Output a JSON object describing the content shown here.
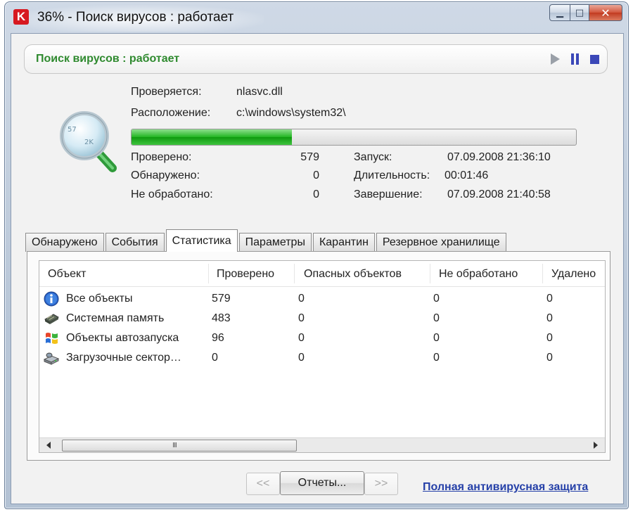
{
  "window": {
    "title": "36% - Поиск вирусов : работает",
    "app_icon_letter": "K",
    "controls": {
      "minimize": "▁",
      "maximize": "□",
      "close": "✕"
    }
  },
  "status": {
    "text": "Поиск вирусов : работает",
    "controls": [
      "play-icon",
      "pause-icon",
      "stop-icon"
    ]
  },
  "scan": {
    "checking_label": "Проверяется:",
    "checking_value": "nlasvc.dll",
    "location_label": "Расположение:",
    "location_value": "c:\\windows\\system32\\",
    "progress_percent": 36
  },
  "stats": {
    "checked_label": "Проверено:",
    "checked_value": "579",
    "detected_label": "Обнаружено:",
    "detected_value": "0",
    "unprocessed_label": "Не обработано:",
    "unprocessed_value": "0",
    "start_label": "Запуск:",
    "start_value": "07.09.2008 21:36:10",
    "duration_label": "Длительность:",
    "duration_value": "00:01:46",
    "end_label": "Завершение:",
    "end_value": "07.09.2008 21:40:58"
  },
  "tabs": [
    {
      "label": "Обнаружено"
    },
    {
      "label": "События"
    },
    {
      "label": "Статистика",
      "active": true
    },
    {
      "label": "Параметры"
    },
    {
      "label": "Карантин"
    },
    {
      "label": "Резервное хранилище"
    }
  ],
  "table": {
    "columns": [
      "Объект",
      "Проверено",
      "Опасных объектов",
      "Не обработано",
      "Удалено"
    ],
    "rows": [
      {
        "icon": "info-icon",
        "cells": [
          "Все объекты",
          "579",
          "0",
          "0",
          "0"
        ]
      },
      {
        "icon": "memory-chip-icon",
        "cells": [
          "Системная память",
          "483",
          "0",
          "0",
          "0"
        ]
      },
      {
        "icon": "windows-logo-icon",
        "cells": [
          "Объекты автозапуска",
          "96",
          "0",
          "0",
          "0"
        ]
      },
      {
        "icon": "disk-drive-icon",
        "cells": [
          "Загрузочные сектор…",
          "0",
          "0",
          "0",
          "0"
        ]
      }
    ],
    "scroll_grip": "III"
  },
  "footer": {
    "prev_label": "<<",
    "reports_label": "Отчеты...",
    "next_label": ">>",
    "link_label": "Полная антивирусная защита"
  },
  "colors": {
    "status_green": "#2f8a2f",
    "progress_green": "#22b522",
    "control_blue": "#3b48b8",
    "link_blue": "#2540a8",
    "brand_red": "#d71920"
  }
}
